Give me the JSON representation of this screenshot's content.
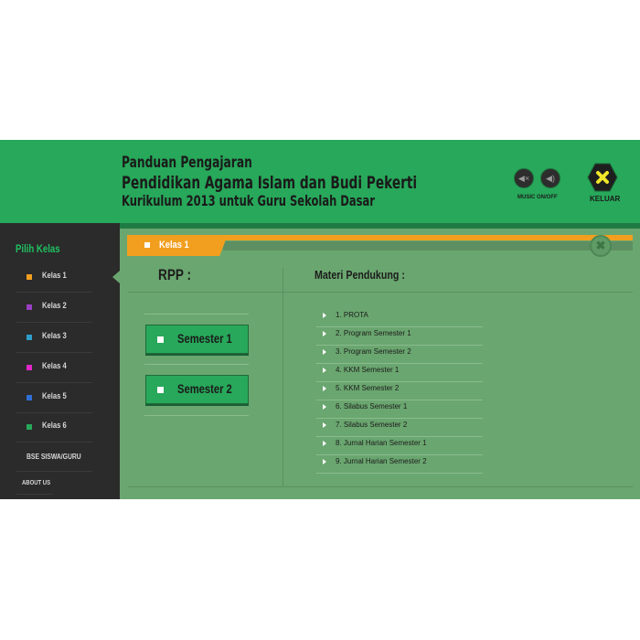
{
  "header": {
    "title_line1": "Panduan Pengajaran",
    "title_line2": "Pendidikan Agama Islam dan Budi Pekerti",
    "title_line3": "Kurikulum 2013 untuk Guru Sekolah Dasar",
    "music_label": "MUSIC ON/OFF",
    "exit_label": "KELUAR",
    "colors": {
      "header_bg": "#27a85a",
      "exit_icon": "#f0e62a"
    }
  },
  "sidebar": {
    "title": "Pilih Kelas",
    "items": [
      {
        "label": "Kelas 1",
        "color": "#f29f1f"
      },
      {
        "label": "Kelas 2",
        "color": "#9b3fc4"
      },
      {
        "label": "Kelas 3",
        "color": "#2e9ec9"
      },
      {
        "label": "Kelas 4",
        "color": "#e027c8"
      },
      {
        "label": "Kelas 5",
        "color": "#2f6fd6"
      },
      {
        "label": "Kelas 6",
        "color": "#27a85a"
      }
    ],
    "extra_1": "BSE SISWA/GURU",
    "extra_2": "ABOUT US"
  },
  "main": {
    "tab_label": "Kelas 1",
    "rpp_title": "RPP :",
    "materi_title": "Materi Pendukung :",
    "semesters": [
      "Semester 1",
      "Semester 2"
    ],
    "materi": [
      "1. PROTA",
      "2. Program Semester 1",
      "3. Program Semester 2",
      "4. KKM Semester 1",
      "5. KKM Semester 2",
      "6. Silabus Semester 1",
      "7. Silabus Semester 2",
      "8. Jurnal Harian Semester 1",
      "9. Jurnal Harian Semester 2"
    ]
  }
}
